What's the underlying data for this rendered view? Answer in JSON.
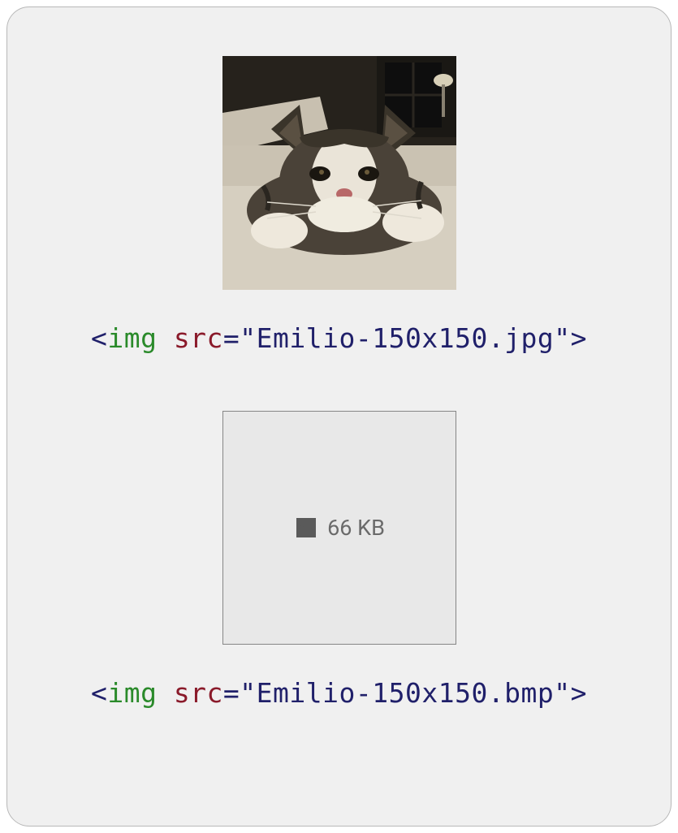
{
  "examples": [
    {
      "tag_open": "<",
      "tag_name": "img",
      "attr_name": "src",
      "attr_eq": "=",
      "attr_quote_open": "\"",
      "attr_value": "Emilio-150x150.jpg",
      "attr_quote_close": "\"",
      "tag_close": ">"
    },
    {
      "tag_open": "<",
      "tag_name": "img",
      "attr_name": "src",
      "attr_eq": "=",
      "attr_quote_open": "\"",
      "attr_value": "Emilio-150x150.bmp",
      "attr_quote_close": "\"",
      "tag_close": ">"
    }
  ],
  "placeholder": {
    "size_label": "66 KB"
  }
}
